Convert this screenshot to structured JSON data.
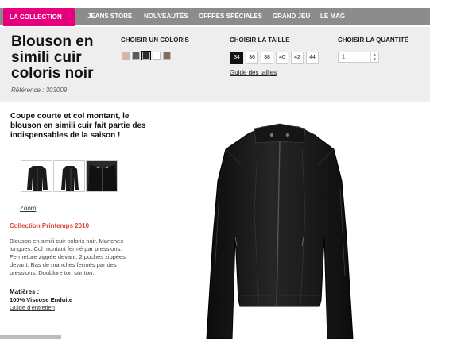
{
  "nav": {
    "active": "LA COLLECTION",
    "items": [
      "JEANS STORE",
      "NOUVEAUTÉS",
      "OFFRES SPÉCIALES",
      "GRAND JEU",
      "LE MAG"
    ]
  },
  "product": {
    "title_lines": [
      "Blouson en",
      "simili cuir",
      "coloris noir"
    ],
    "reference": "Référence : 303009"
  },
  "options": {
    "color_label": "CHOISIR UN COLORIS",
    "colors": [
      "#d9b7a0",
      "#5a5a5a",
      "#2b2b2b",
      "#ffffff",
      "#8a6a5c"
    ],
    "selected_color_index": 2,
    "size_label": "CHOISIR LA TAILLE",
    "sizes": [
      "34",
      "36",
      "38",
      "40",
      "42",
      "44"
    ],
    "selected_size": "34",
    "size_guide": "Guide des tailles",
    "qty_label": "CHOISIR LA QUANTITÉ",
    "qty_value": "1"
  },
  "description": {
    "headline": "Coupe courte et col montant, le blouson en simili cuir fait partie des indispensables de la saison !",
    "zoom": "Zoom",
    "collection": "Collection Printemps 2010",
    "body": "Blouson en simili cuir coloris noir. Manches longues. Col montant fermé par pressions. Fermeture zippée devant. 2 poches zippées devant. Bas de manches fermés par des pressions. Doublure ton sur ton.",
    "matieres_label": "Matières :",
    "matieres_value": "100% Viscose Enduite",
    "care_guide": "Guide d'entretien"
  }
}
